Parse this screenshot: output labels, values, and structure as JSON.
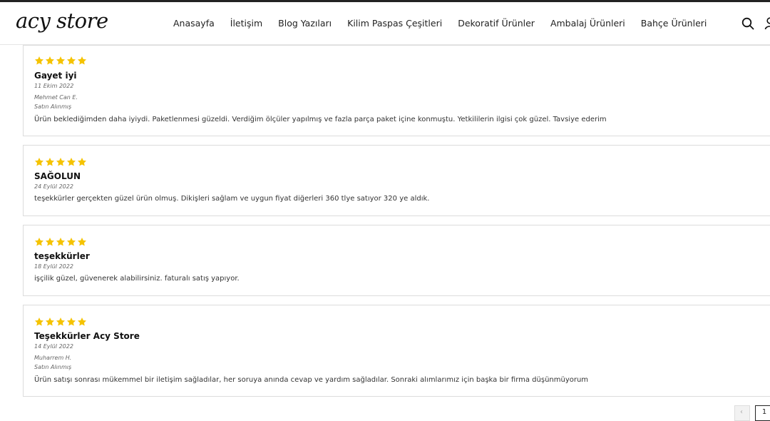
{
  "header": {
    "logo_text": "acy store",
    "nav": [
      "Anasayfa",
      "İletişim",
      "Blog Yazıları",
      "Kilim Paspas Çeşitleri",
      "Dekoratif Ürünler",
      "Ambalaj Ürünleri",
      "Bahçe Ürünleri"
    ],
    "icons": [
      "search-icon",
      "user-icon"
    ]
  },
  "colors": {
    "star": "#f5c300",
    "border": "#dcdcdc",
    "text": "#222222"
  },
  "reviews": [
    {
      "rating": 5,
      "title": "Gayet iyi",
      "date": "11 Ekim 2022",
      "author": "Mehmet Can E.",
      "badge": "Satın Alınmış",
      "text": "Ürün beklediğimden daha iyiydi. Paketlenmesi güzeldi. Verdiğim ölçüler yapılmış ve fazla parça paket içine konmuştu. Yetkililerin ilgisi çok güzel. Tavsiye ederim"
    },
    {
      "rating": 5,
      "title": "SAĞOLUN",
      "date": "24 Eylül 2022",
      "text": "teşekkürler gerçekten güzel ürün olmuş. Dikişleri sağlam ve uygun fiyat diğerleri 360 tlye satıyor 320 ye aldık."
    },
    {
      "rating": 5,
      "title": "teşekkürler",
      "date": "18 Eylül 2022",
      "text": "işçilik güzel, güvenerek alabilirsiniz. faturalı satış yapıyor."
    },
    {
      "rating": 5,
      "title": "Teşekkürler Acy Store",
      "date": "14 Eylül 2022",
      "author": "Muharrem H.",
      "badge": "Satın Alınmış",
      "text": "Ürün satışı sonrası mükemmel bir iletişim sağladılar, her soruya anında cevap ve yardım sağladılar. Sonraki alımlarımız için başka bir firma düşünmüyorum"
    }
  ],
  "pagination": {
    "current": "1"
  }
}
